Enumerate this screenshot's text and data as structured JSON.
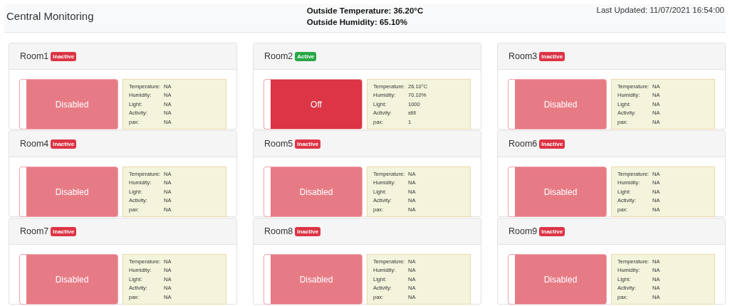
{
  "header": {
    "title": "Central Monitoring",
    "outside_temperature": "Outside Temperature: 36.20°C",
    "outside_humidity": "Outside Humidity: 65.10%",
    "last_updated": "Last Updated: 11/07/2021 16:54:00"
  },
  "rooms": [
    {
      "name": "Room1",
      "active": false,
      "status": "Inactive",
      "switch_disabled": true,
      "switch_on": false,
      "switch_label": "Disabled",
      "readings": [
        {
          "label": "Temperature:",
          "value": "NA"
        },
        {
          "label": "Humidity:",
          "value": "NA"
        },
        {
          "label": "Light:",
          "value": "NA"
        },
        {
          "label": "Activity:",
          "value": "NA"
        },
        {
          "label": "pax:",
          "value": "NA"
        }
      ]
    },
    {
      "name": "Room2",
      "active": true,
      "status": "Active",
      "switch_disabled": false,
      "switch_on": false,
      "switch_label": "Off",
      "readings": [
        {
          "label": "Temperature:",
          "value": "26.10°C"
        },
        {
          "label": "Humidity:",
          "value": "70.10%"
        },
        {
          "label": "Light:",
          "value": "1000"
        },
        {
          "label": "Activity:",
          "value": "still"
        },
        {
          "label": "pax:",
          "value": "1"
        }
      ]
    },
    {
      "name": "Room3",
      "active": false,
      "status": "Inactive",
      "switch_disabled": true,
      "switch_on": false,
      "switch_label": "Disabled",
      "readings": [
        {
          "label": "Temperature:",
          "value": "NA"
        },
        {
          "label": "Humidity:",
          "value": "NA"
        },
        {
          "label": "Light:",
          "value": "NA"
        },
        {
          "label": "Activity:",
          "value": "NA"
        },
        {
          "label": "pax:",
          "value": "NA"
        }
      ]
    },
    {
      "name": "Room4",
      "active": false,
      "status": "Inactive",
      "switch_disabled": true,
      "switch_on": false,
      "switch_label": "Disabled",
      "readings": [
        {
          "label": "Temperature:",
          "value": "NA"
        },
        {
          "label": "Humidity:",
          "value": "NA"
        },
        {
          "label": "Light:",
          "value": "NA"
        },
        {
          "label": "Activity:",
          "value": "NA"
        },
        {
          "label": "pax:",
          "value": "NA"
        }
      ]
    },
    {
      "name": "Room5",
      "active": false,
      "status": "Inactive",
      "switch_disabled": true,
      "switch_on": false,
      "switch_label": "Disabled",
      "readings": [
        {
          "label": "Temperature:",
          "value": "NA"
        },
        {
          "label": "Humidity:",
          "value": "NA"
        },
        {
          "label": "Light:",
          "value": "NA"
        },
        {
          "label": "Activity:",
          "value": "NA"
        },
        {
          "label": "pax:",
          "value": "NA"
        }
      ]
    },
    {
      "name": "Room6",
      "active": false,
      "status": "Inactive",
      "switch_disabled": true,
      "switch_on": false,
      "switch_label": "Disabled",
      "readings": [
        {
          "label": "Temperature:",
          "value": "NA"
        },
        {
          "label": "Humidity:",
          "value": "NA"
        },
        {
          "label": "Light:",
          "value": "NA"
        },
        {
          "label": "Activity:",
          "value": "NA"
        },
        {
          "label": "pax:",
          "value": "NA"
        }
      ]
    },
    {
      "name": "Room7",
      "active": false,
      "status": "Inactive",
      "switch_disabled": true,
      "switch_on": false,
      "switch_label": "Disabled",
      "readings": [
        {
          "label": "Temperature:",
          "value": "NA"
        },
        {
          "label": "Humidity:",
          "value": "NA"
        },
        {
          "label": "Light:",
          "value": "NA"
        },
        {
          "label": "Activity:",
          "value": "NA"
        },
        {
          "label": "pax:",
          "value": "NA"
        }
      ]
    },
    {
      "name": "Room8",
      "active": false,
      "status": "Inactive",
      "switch_disabled": true,
      "switch_on": false,
      "switch_label": "Disabled",
      "readings": [
        {
          "label": "Temperature:",
          "value": "NA"
        },
        {
          "label": "Humidity:",
          "value": "NA"
        },
        {
          "label": "Light:",
          "value": "NA"
        },
        {
          "label": "Activity:",
          "value": "NA"
        },
        {
          "label": "pax:",
          "value": "NA"
        }
      ]
    },
    {
      "name": "Room9",
      "active": false,
      "status": "Inactive",
      "switch_disabled": true,
      "switch_on": false,
      "switch_label": "Disabled",
      "readings": [
        {
          "label": "Temperature:",
          "value": "NA"
        },
        {
          "label": "Humidity:",
          "value": "NA"
        },
        {
          "label": "Light:",
          "value": "NA"
        },
        {
          "label": "Activity:",
          "value": "NA"
        },
        {
          "label": "pax:",
          "value": "NA"
        }
      ]
    }
  ]
}
